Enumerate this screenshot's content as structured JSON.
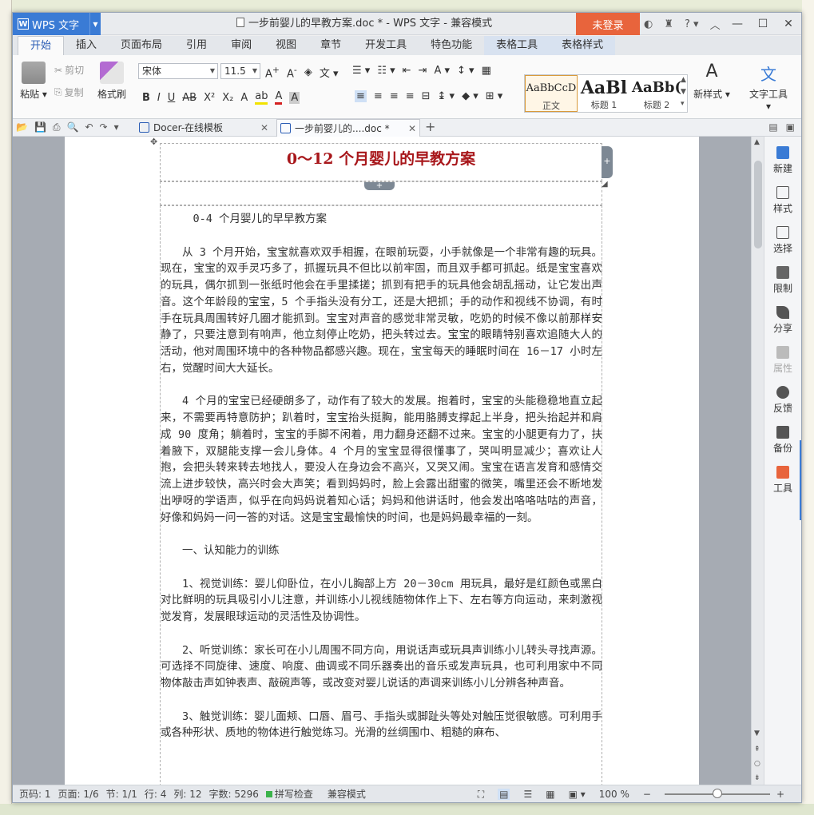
{
  "window": {
    "app_name": "WPS 文字",
    "title": "一步前婴儿的早教方案.doc * - WPS 文字 - 兼容模式",
    "login_label": "未登录",
    "help_label": "?"
  },
  "ribbon_tabs": [
    {
      "label": "开始",
      "active": true
    },
    {
      "label": "插入"
    },
    {
      "label": "页面布局"
    },
    {
      "label": "引用"
    },
    {
      "label": "审阅"
    },
    {
      "label": "视图"
    },
    {
      "label": "章节"
    },
    {
      "label": "开发工具"
    },
    {
      "label": "特色功能"
    },
    {
      "label": "表格工具",
      "context": true
    },
    {
      "label": "表格样式",
      "context": true
    }
  ],
  "ribbon": {
    "paste": "粘贴",
    "cut": "剪切",
    "copy": "复制",
    "format_painter": "格式刷",
    "font_name": "宋体",
    "font_size": "11.5",
    "styles": [
      {
        "sample": "AaBbCcD",
        "name": "正文"
      },
      {
        "sample": "AaBl",
        "name": "标题 1"
      },
      {
        "sample": "AaBb(",
        "name": "标题 2"
      }
    ],
    "new_style": "新样式",
    "text_tools": "文字工具"
  },
  "doc_tabs": [
    {
      "label": "Docer-在线模板"
    },
    {
      "label": "一步前婴儿的....doc *",
      "active": true
    }
  ],
  "document": {
    "title": "0～12 个月婴儿的早教方案",
    "paragraphs": [
      "0-4 个月婴儿的早早教方案",
      "从 3 个月开始，宝宝就喜欢双手相握，在眼前玩耍，小手就像是一个非常有趣的玩具。现在，宝宝的双手灵巧多了，抓握玩具不但比以前牢固，而且双手都可抓起。纸是宝宝喜欢的玩具，偶尔抓到一张纸时他会在手里揉搓；抓到有把手的玩具他会胡乱摇动，让它发出声音。这个年龄段的宝宝，5 个手指头没有分工，还是大把抓；手的动作和视线不协调，有时手在玩具周围转好几圈才能抓到。宝宝对声音的感觉非常灵敏，吃奶的时候不像以前那样安静了，只要注意到有响声，他立刻停止吃奶，把头转过去。宝宝的眼睛特别喜欢追随大人的活动，他对周围环境中的各种物品都感兴趣。现在，宝宝每天的睡眠时间在 16－17 小时左右，觉醒时间大大延长。",
      "4 个月的宝宝已经硬朗多了，动作有了较大的发展。抱着时，宝宝的头能稳稳地直立起来，不需要再特意防护；趴着时，宝宝抬头挺胸，能用胳膊支撑起上半身，把头抬起并和肩成 90 度角；躺着时，宝宝的手脚不闲着，用力翻身还翻不过来。宝宝的小腿更有力了，扶着腋下，双腿能支撑一会儿身体。4 个月的宝宝显得很懂事了，哭叫明显减少；喜欢让人抱，会把头转来转去地找人，要没人在身边会不高兴，又哭又闹。宝宝在语言发育和感情交流上进步较快，高兴时会大声笑；看到妈妈时，脸上会露出甜蜜的微笑，嘴里还会不断地发出咿呀的学语声，似乎在向妈妈说着知心话；妈妈和他讲话时，他会发出咯咯咕咕的声音，好像和妈妈一问一答的对话。这是宝宝最愉快的时间，也是妈妈最幸福的一刻。",
      "一、认知能力的训练",
      "1、视觉训练：婴儿仰卧位，在小儿胸部上方 20－30cm 用玩具，最好是红颜色或黑白对比鲜明的玩具吸引小儿注意，并训练小儿视线随物体作上下、左右等方向运动，来刺激视觉发育，发展眼球运动的灵活性及协调性。",
      "2、听觉训练：家长可在小儿周围不同方向，用说话声或玩具声训练小儿转头寻找声源。可选择不同旋律、速度、响度、曲调或不同乐器奏出的音乐或发声玩具，也可利用家中不同物体敲击声如钟表声、敲碗声等，或改变对婴儿说话的声调来训练小儿分辨各种声音。",
      "3、触觉训练：婴儿面颊、口唇、眉弓、手指头或脚趾头等处对触压觉很敏感。可利用手或各种形状、质地的物体进行触觉练习。光滑的丝绸围巾、粗糙的麻布、"
    ]
  },
  "sidebar": [
    {
      "label": "新建"
    },
    {
      "label": "样式"
    },
    {
      "label": "选择"
    },
    {
      "label": "限制"
    },
    {
      "label": "分享"
    },
    {
      "label": "属性",
      "disabled": true
    },
    {
      "label": "反馈"
    },
    {
      "label": "备份"
    },
    {
      "label": "工具"
    }
  ],
  "status": {
    "page_num": "页码: 1",
    "pages": "页面: 1/6",
    "section": "节: 1/1",
    "row": "行: 4",
    "col": "列: 12",
    "word_count": "字数: 5296",
    "spell_check": "拼写检查",
    "compat_mode": "兼容模式",
    "zoom": "100 %"
  },
  "colors": {
    "app_blue": "#3a7bd5",
    "login_orange": "#e8643c",
    "title_red": "#a8171b"
  }
}
